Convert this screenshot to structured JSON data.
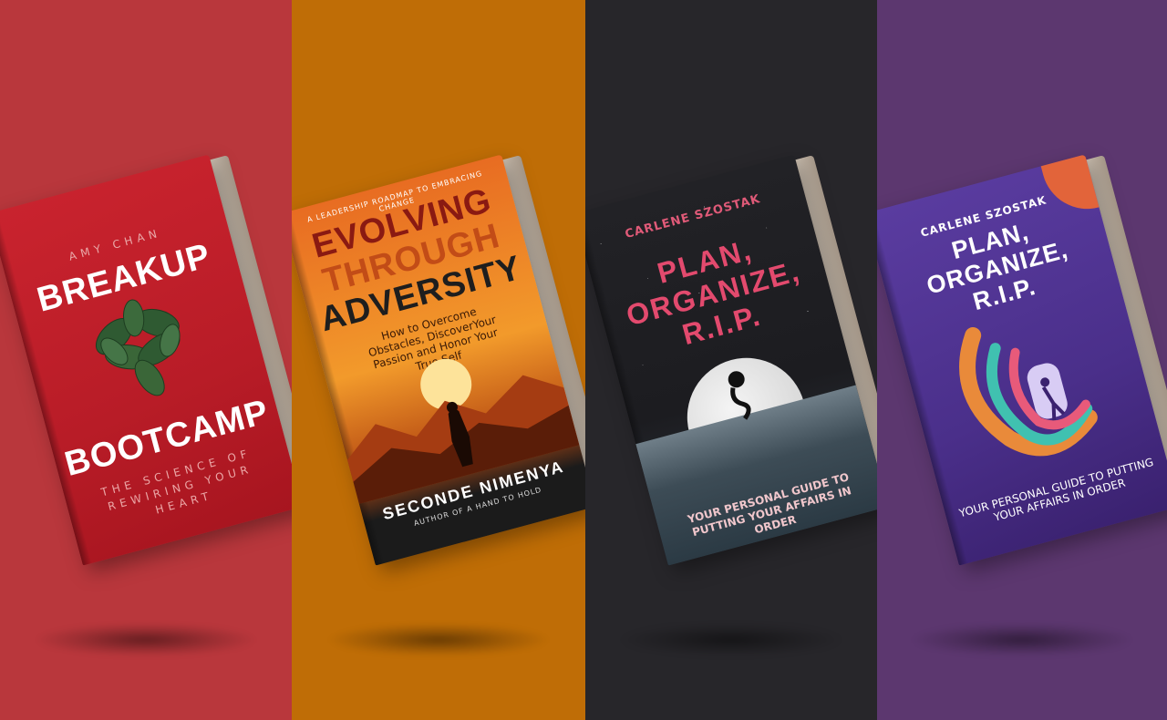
{
  "panels": [
    {
      "bg": "#b9373c",
      "book": {
        "author": "AMY CHAN",
        "title_line1": "BREAKUP",
        "title_line2": "BOOTCAMP",
        "subtitle": "THE SCIENCE OF REWIRING YOUR HEART",
        "cover_color": "#c9232e"
      }
    },
    {
      "bg": "#bf6d06",
      "book": {
        "tagline": "A LEADERSHIP ROADMAP TO EMBRACING CHANGE",
        "title_line1": "EVOLVING",
        "title_line2": "THROUGH",
        "title_line3": "ADVERSITY",
        "subtitle": "How to Overcome Obstacles, DiscoverYour Passion and Honor Your True Self",
        "author": "SECONDE NIMENYA",
        "byline": "AUTHOR OF A HAND TO HOLD"
      }
    },
    {
      "bg": "#27262a",
      "book": {
        "author": "CARLENE SZOSTAK",
        "title_line1": "PLAN,",
        "title_line2": "ORGANIZE,",
        "title_line3": "R.I.P.",
        "subtitle": "YOUR PERSONAL GUIDE TO PUTTING YOUR AFFAIRS IN ORDER"
      }
    },
    {
      "bg": "#5c376f",
      "book": {
        "author": "CARLENE SZOSTAK",
        "title_line1": "PLAN,",
        "title_line2": "ORGANIZE,",
        "title_line3": "R.I.P.",
        "subtitle": "YOUR PERSONAL GUIDE TO PUTTING YOUR AFFAIRS IN ORDER"
      }
    }
  ]
}
